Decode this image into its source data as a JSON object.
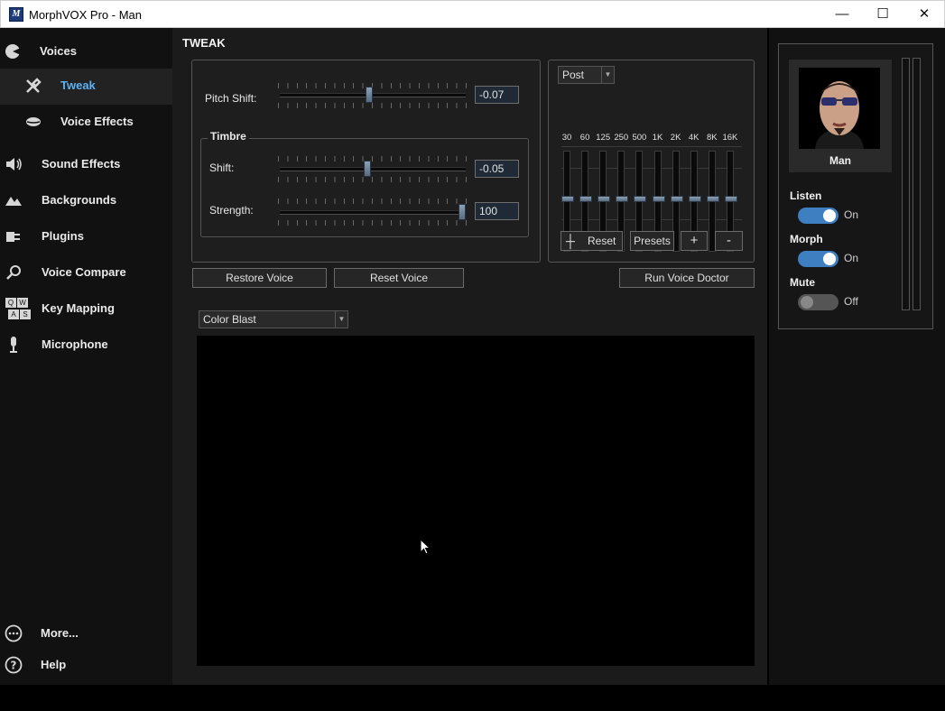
{
  "window": {
    "title": "MorphVOX Pro - Man",
    "app_icon_letter": "M",
    "minimize": "—",
    "maximize": "☐",
    "close": "✕"
  },
  "sidebar": {
    "items": [
      {
        "label": "Voices"
      },
      {
        "label": "Tweak"
      },
      {
        "label": "Voice Effects"
      },
      {
        "label": "Sound Effects"
      },
      {
        "label": "Backgrounds"
      },
      {
        "label": "Plugins"
      },
      {
        "label": "Voice Compare"
      },
      {
        "label": "Key Mapping"
      },
      {
        "label": "Microphone"
      },
      {
        "label": "More..."
      },
      {
        "label": "Help"
      }
    ],
    "keymap_keys": [
      "Q",
      "W",
      "A",
      "S"
    ]
  },
  "tweak": {
    "heading": "TWEAK",
    "pitch_label": "Pitch Shift:",
    "pitch_value": "-0.07",
    "pitch_fraction": 0.48,
    "timbre_legend": "Timbre",
    "shift_label": "Shift:",
    "shift_value": "-0.05",
    "shift_fraction": 0.47,
    "strength_label": "Strength:",
    "strength_value": "100",
    "strength_fraction": 1.0,
    "restore_label": "Restore Voice",
    "reset_label": "Reset Voice",
    "doctor_label": "Run Voice Doctor"
  },
  "equalizer": {
    "mode": "Post",
    "bands": [
      "30",
      "60",
      "125",
      "250",
      "500",
      "1K",
      "2K",
      "4K",
      "8K",
      "16K"
    ],
    "levels": [
      0.5,
      0.5,
      0.5,
      0.5,
      0.5,
      0.5,
      0.5,
      0.5,
      0.5,
      0.5
    ],
    "reset_label": "Reset",
    "presets_label": "Presets",
    "add_label": "+",
    "remove_label": "-"
  },
  "visualizer": {
    "selected": "Color Blast"
  },
  "voice_panel": {
    "name": "Man",
    "listen_label": "Listen",
    "listen_state": "On",
    "morph_label": "Morph",
    "morph_state": "On",
    "mute_label": "Mute",
    "mute_state": "Off"
  },
  "colors": {
    "accent": "#5fb0f0",
    "toggle_on": "#3d7fc1",
    "background": "#1b1b1b"
  }
}
